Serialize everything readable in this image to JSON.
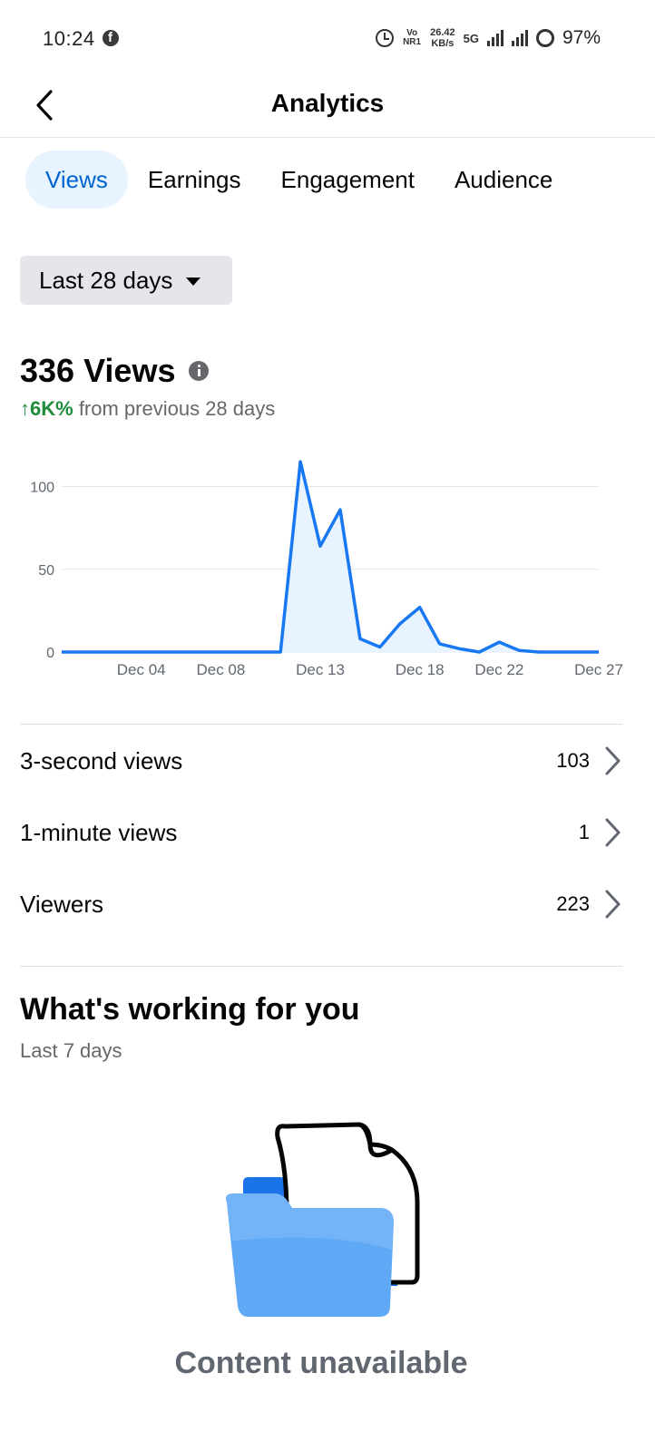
{
  "status_bar": {
    "time": "10:24",
    "app_icon": "facebook-icon",
    "volte_top": "Vo",
    "volte_bottom": "NR1",
    "speed_value": "26.42",
    "speed_unit": "KB/s",
    "network": "5G",
    "battery": "97%"
  },
  "header": {
    "title": "Analytics",
    "back_icon": "back-arrow-icon"
  },
  "tabs": [
    {
      "label": "Views",
      "active": true
    },
    {
      "label": "Earnings",
      "active": false
    },
    {
      "label": "Engagement",
      "active": false
    },
    {
      "label": "Audience",
      "active": false
    }
  ],
  "filter": {
    "label": "Last 28 days"
  },
  "summary": {
    "total": "336 Views",
    "change_value": "↑6K%",
    "change_text": "from previous 28 days"
  },
  "chart_data": {
    "type": "area",
    "x": [
      "Nov 30",
      "Dec 01",
      "Dec 02",
      "Dec 03",
      "Dec 04",
      "Dec 05",
      "Dec 06",
      "Dec 07",
      "Dec 08",
      "Dec 09",
      "Dec 10",
      "Dec 11",
      "Dec 12",
      "Dec 13",
      "Dec 14",
      "Dec 15",
      "Dec 16",
      "Dec 17",
      "Dec 18",
      "Dec 19",
      "Dec 20",
      "Dec 21",
      "Dec 22",
      "Dec 23",
      "Dec 24",
      "Dec 25",
      "Dec 26",
      "Dec 27"
    ],
    "values": [
      0,
      0,
      0,
      0,
      0,
      0,
      0,
      0,
      0,
      0,
      0,
      0,
      115,
      64,
      86,
      8,
      3,
      17,
      27,
      5,
      2,
      0,
      6,
      1,
      0,
      0,
      0,
      0
    ],
    "x_tick_labels": [
      "Dec 04",
      "Dec 08",
      "Dec 13",
      "Dec 18",
      "Dec 22",
      "Dec 27"
    ],
    "y_ticks": [
      0,
      50,
      100
    ],
    "ylim": [
      0,
      120
    ],
    "grid": true,
    "line_color": "#1877f2",
    "fill_color": "#e7f3ff"
  },
  "metrics": [
    {
      "label": "3-second views",
      "value": "103"
    },
    {
      "label": "1-minute views",
      "value": "1"
    },
    {
      "label": "Viewers",
      "value": "223"
    }
  ],
  "working_section": {
    "title": "What's working for you",
    "subtitle": "Last 7 days",
    "illustration": "folder-document-icon",
    "empty_title": "Content unavailable"
  }
}
